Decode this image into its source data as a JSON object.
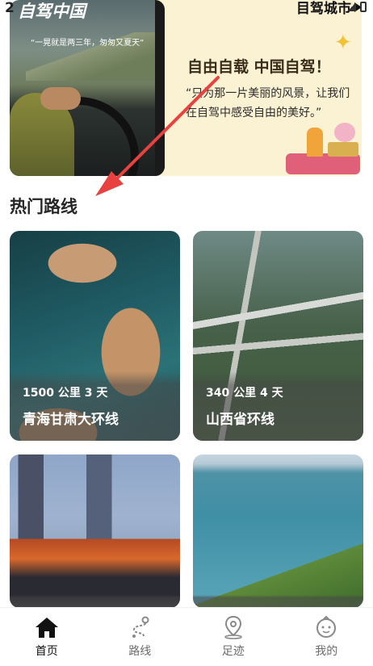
{
  "status_bar": {
    "time_partial": "2"
  },
  "header": {
    "city_label": "目驾城市"
  },
  "hero": {
    "photo_title": "自驾中国",
    "photo_quote": "“一晃就是两三年，匆匆又夏天”",
    "title": "自由自载 中国自驾！",
    "quote": "“只为那一片美丽的风景，让我们在自驾中感受自由的美好。”"
  },
  "section": {
    "hot_routes_title": "热门路线"
  },
  "routes": [
    {
      "meta": "1500 公里  3 天",
      "name": "青海甘肃大环线"
    },
    {
      "meta": "340 公里  4 天",
      "name": "山西省环线"
    },
    {
      "meta": "",
      "name": ""
    },
    {
      "meta": "",
      "name": ""
    }
  ],
  "nav": {
    "items": [
      {
        "label": "首页",
        "icon": "home-icon",
        "active": true
      },
      {
        "label": "路线",
        "icon": "route-icon",
        "active": false
      },
      {
        "label": "足迹",
        "icon": "location-pin-icon",
        "active": false
      },
      {
        "label": "我的",
        "icon": "profile-face-icon",
        "active": false
      }
    ]
  },
  "colors": {
    "arrow": "#e8413f",
    "hero_bg": "#fbf1d3",
    "text_dark": "#262626"
  }
}
